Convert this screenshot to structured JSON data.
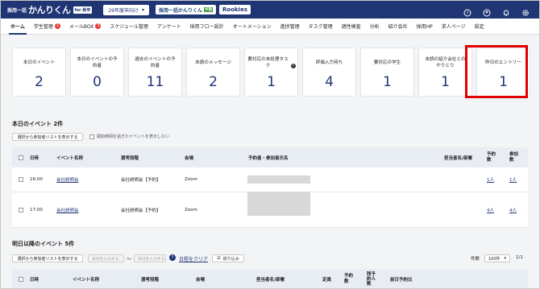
{
  "topbar": {
    "logo_small": "採用一括",
    "logo_big": "かんりくん",
    "logo_badge": "for 新卒",
    "year_select": "29年度卒向け",
    "ext1": "採用一括かんりくん",
    "ext1_badge": "中途",
    "ext2": "Rookies"
  },
  "nav": [
    {
      "label": "ホーム",
      "active": true
    },
    {
      "label": "学生管理",
      "badge": "1"
    },
    {
      "label": "メールBOX",
      "badge": "3"
    },
    {
      "label": "スケジュール管理"
    },
    {
      "label": "アンケート"
    },
    {
      "label": "採用フロー設計"
    },
    {
      "label": "オートメーション"
    },
    {
      "label": "進捗管理"
    },
    {
      "label": "タスク管理"
    },
    {
      "label": "適性検査"
    },
    {
      "label": "分析"
    },
    {
      "label": "紹介会社"
    },
    {
      "label": "採用HP"
    },
    {
      "label": "求人ページ"
    },
    {
      "label": "設定"
    }
  ],
  "cards": [
    {
      "label": "本日のイベント",
      "value": "2"
    },
    {
      "label": "本日のイベントの予約者",
      "value": "0"
    },
    {
      "label": "過去のイベントの予約者",
      "value": "11"
    },
    {
      "label": "未読のメッセージ",
      "value": "2"
    },
    {
      "label": "要対応の未処理タスク",
      "value": "1"
    },
    {
      "label": "評価入力待ち",
      "value": "4"
    },
    {
      "label": "要対応の学生",
      "value": "1"
    },
    {
      "label": "未読の紹介会社とのやりとり",
      "value": "1"
    },
    {
      "label": "昨日のエントリー",
      "value": "1"
    }
  ],
  "today": {
    "title": "本日のイベント 2件",
    "select_btn": "選択から参加者リストを表示する",
    "hide_past": "開始時間を過ぎたイベントを表示しない",
    "headers": {
      "time": "日時",
      "name": "イベント名称",
      "stage": "選考段階",
      "venue": "会場",
      "participants": "予約者・参加者氏名",
      "staff": "担当者名/部署",
      "reserve": "予約数",
      "attend": "参加数"
    },
    "rows": [
      {
        "time": "16:00",
        "name": "会社説明会",
        "stage": "会社説明会【予約】",
        "venue": "Zoom",
        "reserve": "1人",
        "attend": "1人"
      },
      {
        "time": "17:00",
        "name": "会社説明会",
        "stage": "会社説明会【予約】",
        "venue": "Zoom",
        "reserve": "4人",
        "attend": "4人"
      }
    ]
  },
  "upcoming": {
    "title": "明日以降のイベント 5件",
    "select_btn": "選択から参加者リストを表示する",
    "date_from": "日付を入力する",
    "date_to": "日付を入力する",
    "tilde": "〜",
    "clear": "日程をクリア",
    "filter": "絞り込み",
    "count_label": "件数",
    "per_page": "100件",
    "page": "1/1",
    "headers": {
      "time": "日時",
      "name": "イベント名称",
      "stage": "選考段階",
      "venue": "会場",
      "staff": "担当者名/部署",
      "capacity": "定員",
      "reserve": "予約数",
      "remain": "残予約人数",
      "deadline": "前日予約比"
    }
  }
}
